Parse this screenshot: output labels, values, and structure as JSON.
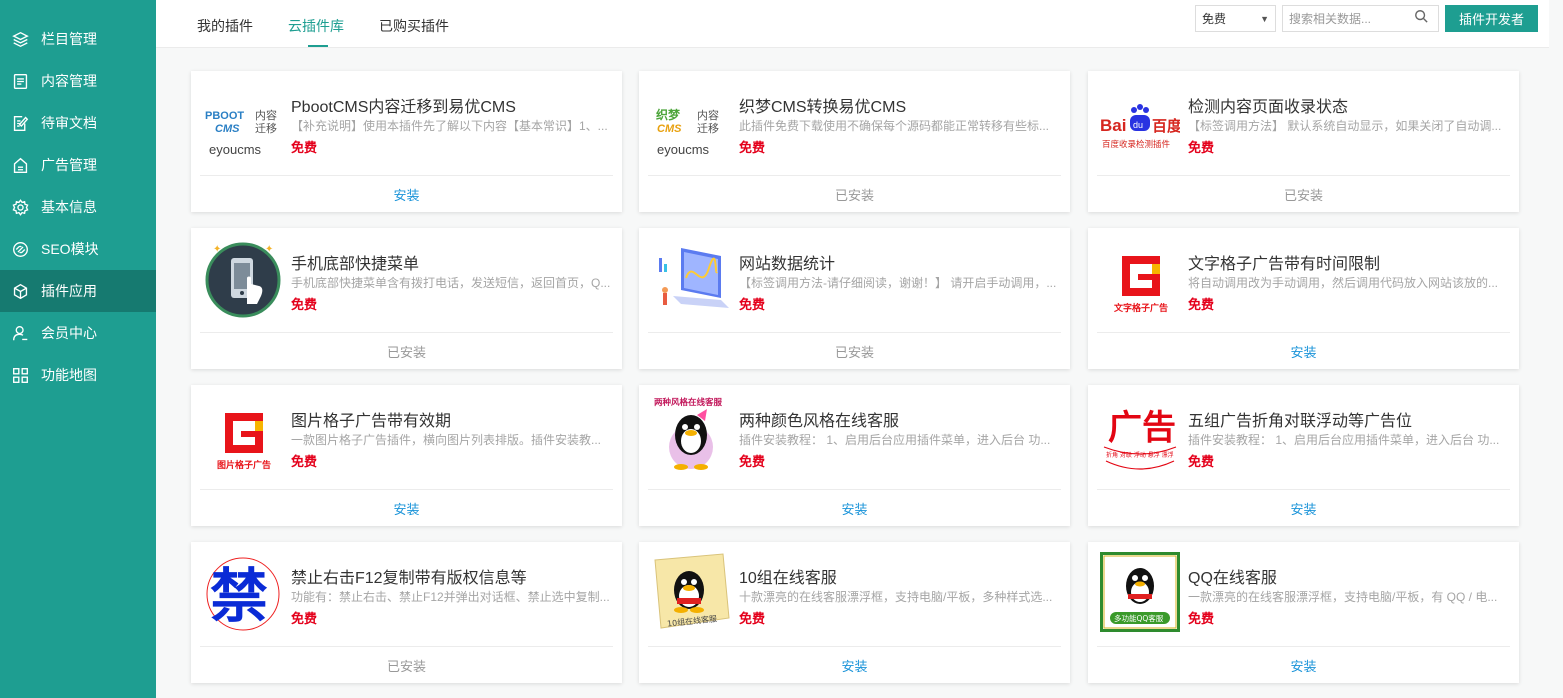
{
  "sidebar": {
    "items": [
      {
        "label": "栏目管理",
        "icon": "layers-icon"
      },
      {
        "label": "内容管理",
        "icon": "document-icon"
      },
      {
        "label": "待审文档",
        "icon": "edit-doc-icon"
      },
      {
        "label": "广告管理",
        "icon": "ad-icon"
      },
      {
        "label": "基本信息",
        "icon": "gear-icon"
      },
      {
        "label": "SEO模块",
        "icon": "link-icon"
      },
      {
        "label": "插件应用",
        "icon": "cube-icon",
        "active": true
      },
      {
        "label": "会员中心",
        "icon": "user-icon"
      },
      {
        "label": "功能地图",
        "icon": "grid-icon"
      }
    ]
  },
  "tabs": [
    "我的插件",
    "云插件库",
    "已购买插件"
  ],
  "active_tab": "云插件库",
  "filter": {
    "selected": "免费"
  },
  "search": {
    "placeholder": "搜索相关数据..."
  },
  "developer_button": "插件开发者",
  "colors": {
    "accent": "#1e9e91",
    "price": "#e4001b",
    "install": "#1b94d9"
  },
  "plugins": [
    {
      "title": "PbootCMS内容迁移到易优CMS",
      "desc": "【补充说明】使用本插件先了解以下内容【基本常识】1、...",
      "price": "免费",
      "action": "安装",
      "installed": false,
      "logo_text": [
        "PBOOT",
        "CMS",
        "内容",
        "迁移",
        "eyoucms"
      ]
    },
    {
      "title": "织梦CMS转换易优CMS",
      "desc": "此插件免费下载使用不确保每个源码都能正常转移有些标...",
      "price": "免费",
      "action": "已安装",
      "installed": true,
      "logo_text": [
        "织梦",
        "CMS",
        "内容",
        "迁移",
        "eyoucms"
      ]
    },
    {
      "title": "检测内容页面收录状态",
      "desc": "【标签调用方法】 默认系统自动显示，如果关闭了自动调...",
      "price": "免费",
      "action": "已安装",
      "installed": true,
      "logo_text": [
        "Bai",
        "du",
        "百度",
        "百度收录检测插件"
      ]
    },
    {
      "title": "手机底部快捷菜单",
      "desc": "手机底部快捷菜单含有拨打电话，发送短信，返回首页，Q...",
      "price": "免费",
      "action": "已安装",
      "installed": true,
      "logo_text": []
    },
    {
      "title": "网站数据统计",
      "desc": "【标签调用方法-请仔细阅读，谢谢！】 请开启手动调用，...",
      "price": "免费",
      "action": "已安装",
      "installed": true,
      "logo_text": []
    },
    {
      "title": "文字格子广告带有时间限制",
      "desc": "将自动调用改为手动调用，然后调用代码放入网站该放的...",
      "price": "免费",
      "action": "安装",
      "installed": false,
      "logo_text": [
        "文字格子广告"
      ]
    },
    {
      "title": "图片格子广告带有效期",
      "desc": "一款图片格子广告插件，横向图片列表排版。插件安装教...",
      "price": "免费",
      "action": "安装",
      "installed": false,
      "logo_text": [
        "图片格子广告"
      ]
    },
    {
      "title": "两种颜色风格在线客服",
      "desc": "插件安装教程： 1、启用后台应用插件菜单，进入后台 功...",
      "price": "免费",
      "action": "安装",
      "installed": false,
      "logo_text": [
        "两种风格在线客服"
      ]
    },
    {
      "title": "五组广告折角对联浮动等广告位",
      "desc": "插件安装教程： 1、启用后台应用插件菜单，进入后台 功...",
      "price": "免费",
      "action": "安装",
      "installed": false,
      "logo_text": [
        "广告",
        "折角 对联 浮动 悬浮 漂浮"
      ]
    },
    {
      "title": "禁止右击F12复制带有版权信息等",
      "desc": "功能有：禁止右击、禁止F12并弹出对话框、禁止选中复制...",
      "price": "免费",
      "action": "已安装",
      "installed": true,
      "logo_text": [
        "禁"
      ]
    },
    {
      "title": "10组在线客服",
      "desc": "十款漂亮的在线客服漂浮框，支持电脑/平板，多种样式选...",
      "price": "免费",
      "action": "安装",
      "installed": false,
      "logo_text": [
        "10组在线客服"
      ]
    },
    {
      "title": "QQ在线客服",
      "desc": "一款漂亮的在线客服漂浮框，支持电脑/平板，有 QQ / 电...",
      "price": "免费",
      "action": "安装",
      "installed": false,
      "logo_text": [
        "多功能QQ客服"
      ]
    }
  ]
}
